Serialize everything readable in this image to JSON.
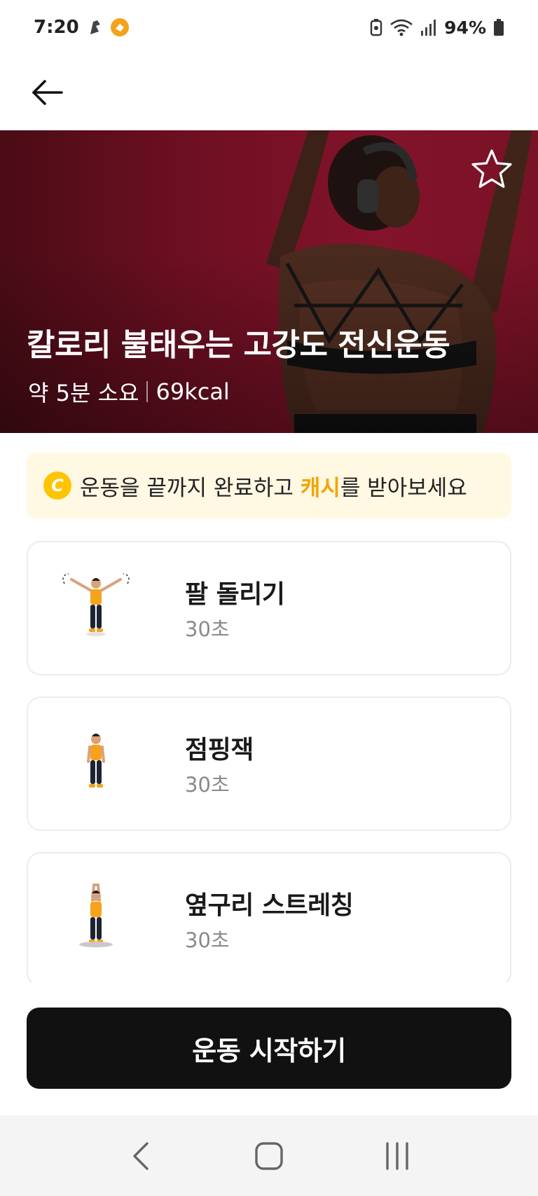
{
  "status_bar": {
    "time": "7:20",
    "battery_percent": "94%",
    "icons": [
      "notification-app-icon",
      "notification-coin-icon",
      "battery-saver-icon",
      "wifi-icon",
      "signal-icon",
      "battery-icon"
    ]
  },
  "app_bar": {
    "back_icon": "arrow-left-icon"
  },
  "hero": {
    "title": "칼로리 불태우는 고강도 전신운동",
    "duration": "약 5분 소요",
    "calories": "69kcal",
    "favorite_icon": "star-outline-icon",
    "background_color": "#7a1226"
  },
  "cash_banner": {
    "coin_letter": "C",
    "text_before": "운동을 끝까지 완료하고 ",
    "highlight": "캐시",
    "text_after": "를 받아보세요",
    "highlight_color": "#f5a300",
    "background_color": "#fff8e3"
  },
  "exercises": [
    {
      "name": "팔 돌리기",
      "duration": "30초",
      "figure": "arm-circles-figure"
    },
    {
      "name": "점핑잭",
      "duration": "30초",
      "figure": "jumping-jack-figure"
    },
    {
      "name": "옆구리 스트레칭",
      "duration": "30초",
      "figure": "side-stretch-figure"
    }
  ],
  "cta": {
    "label": "운동 시작하기",
    "background_color": "#111111"
  },
  "nav_bar": {
    "icons": [
      "nav-back-icon",
      "nav-home-icon",
      "nav-recents-icon"
    ]
  }
}
